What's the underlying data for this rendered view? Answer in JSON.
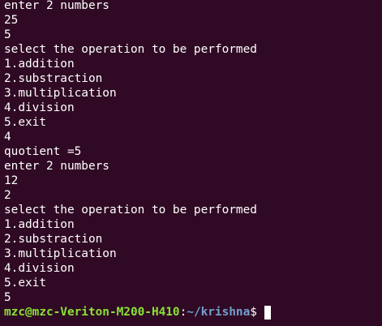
{
  "colors": {
    "background": "#300a24",
    "text": "#ffffff",
    "user_host": "#8ae234",
    "path": "#729fcf",
    "cursor": "#ffffff"
  },
  "terminal": {
    "lines": [
      "enter 2 numbers",
      "25",
      "5",
      "select the operation to be performed",
      "1.addition",
      "2.substraction",
      "3.multiplication",
      "4.division",
      "5.exit",
      "4",
      "quotient =5",
      "enter 2 numbers",
      "12",
      "2",
      "select the operation to be performed",
      "1.addition",
      "2.substraction",
      "3.multiplication",
      "4.division",
      "5.exit",
      "5"
    ],
    "prompt": {
      "user_host": "mzc@mzc-Veriton-M200-H410",
      "separator": ":",
      "path": "~/krishna",
      "symbol": "$"
    }
  }
}
